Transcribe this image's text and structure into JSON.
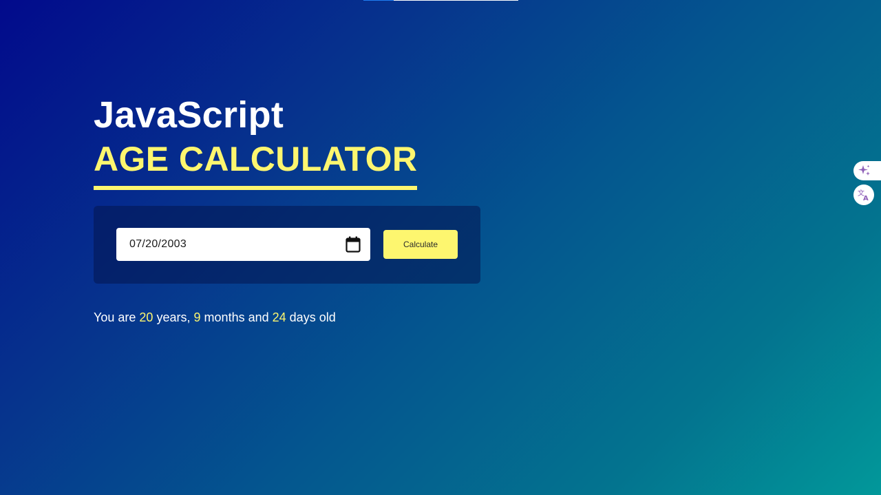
{
  "header": {
    "title_line1": "JavaScript",
    "title_line2": "AGE CALCULATOR"
  },
  "form": {
    "date_value": "07/20/2003",
    "calculate_label": "Calculate"
  },
  "result": {
    "prefix": "You are",
    "years": "20",
    "years_word": "years,",
    "months": "9",
    "months_word": "months and",
    "days": "24",
    "days_word": "days old"
  },
  "icons": {
    "calendar": "calendar-icon",
    "sparkle": "sparkle-icon",
    "translate": "translate-icon"
  },
  "colors": {
    "accent": "#fdf66f",
    "text": "#ffffff",
    "side_icon": "#8e5fb8"
  }
}
